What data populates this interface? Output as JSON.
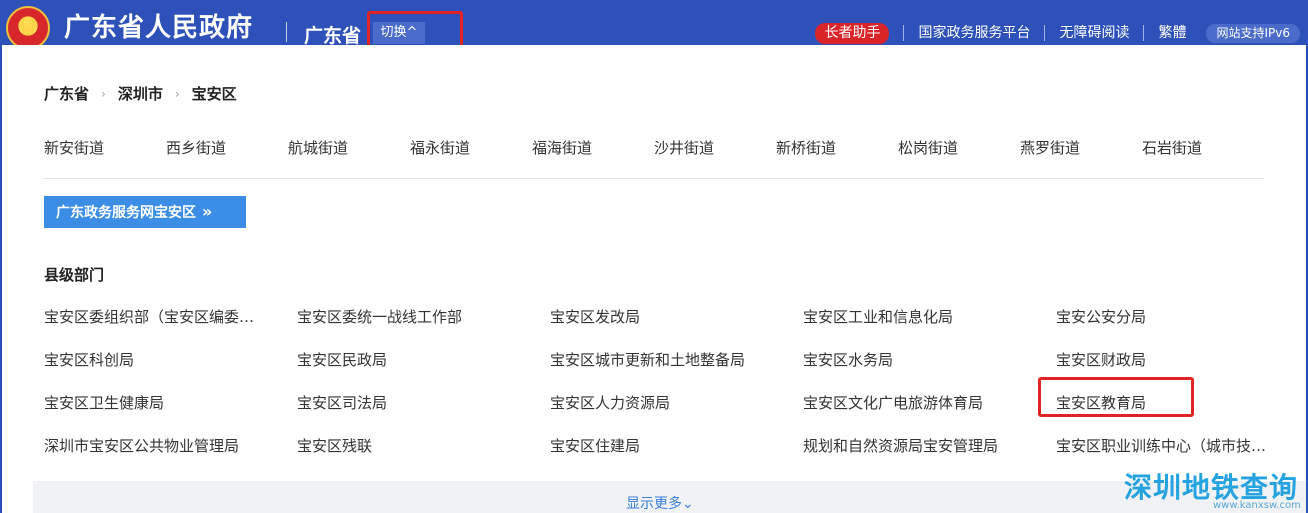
{
  "header": {
    "site_title": "广东省人民政府",
    "province": "广东省",
    "switch_label": "切换",
    "switch_chevron": "^",
    "elder_mode": "长者助手",
    "links": [
      "国家政务服务平台",
      "无障碍阅读",
      "繁體"
    ],
    "ipv6": "网站支持IPv6"
  },
  "breadcrumb": [
    "广东省",
    "深圳市",
    "宝安区"
  ],
  "breadcrumb_sep": "›",
  "streets": [
    "新安街道",
    "西乡街道",
    "航城街道",
    "福永街道",
    "福海街道",
    "沙井街道",
    "新桥街道",
    "松岗街道",
    "燕罗街道",
    "石岩街道"
  ],
  "service_button": {
    "label": "广东政务服务网宝安区",
    "chevron": "»"
  },
  "section_title": "县级部门",
  "departments": [
    "宝安区委组织部（宝安区编委办）",
    "宝安区委统一战线工作部",
    "宝安区发改局",
    "宝安区工业和信息化局",
    "宝安公安分局",
    "宝安区科创局",
    "宝安区民政局",
    "宝安区城市更新和土地整备局",
    "宝安区水务局",
    "宝安区财政局",
    "宝安区卫生健康局",
    "宝安区司法局",
    "宝安区人力资源局",
    "宝安区文化广电旅游体育局",
    "宝安区教育局",
    "深圳市宝安区公共物业管理局",
    "宝安区残联",
    "宝安区住建局",
    "规划和自然资源局宝安管理局",
    "宝安区职业训练中心（城市技师学院）"
  ],
  "show_more": "显示更多",
  "show_more_chevron": "⌄",
  "watermark": {
    "text": "深圳地铁查询",
    "url": "www.kanxsw.com"
  },
  "colors": {
    "header_bg": "#2d51b8",
    "badge_red": "#d9252a",
    "button_blue": "#3c8de6",
    "highlight_red": "#e02424"
  }
}
